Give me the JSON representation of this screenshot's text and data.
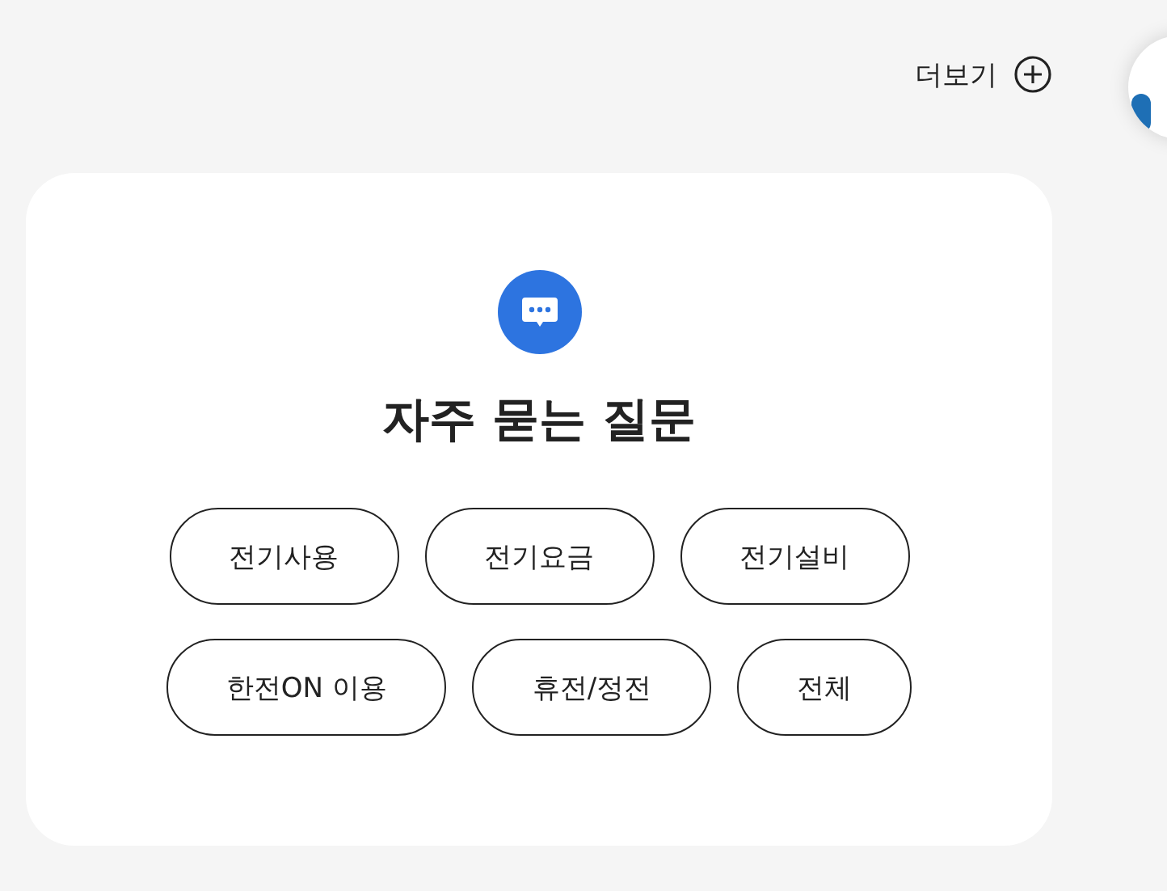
{
  "more_link": {
    "label": "더보기"
  },
  "faq": {
    "title": "자주 묻는 질문",
    "categories": [
      [
        "전기사용",
        "전기요금",
        "전기설비"
      ],
      [
        "한전ON 이용",
        "휴전/정전",
        "전체"
      ]
    ]
  }
}
